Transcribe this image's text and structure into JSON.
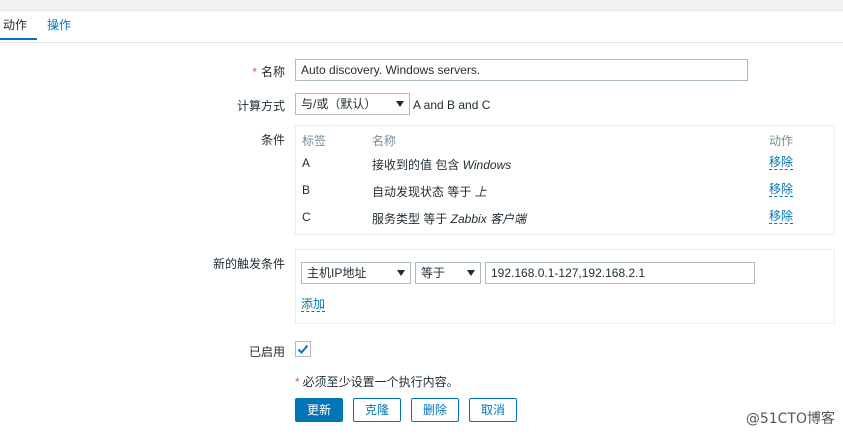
{
  "tabs": [
    {
      "label": "动作",
      "active": true
    },
    {
      "label": "操作",
      "active": false
    }
  ],
  "form": {
    "name": {
      "required_mark": "*",
      "label": "名称",
      "value": "Auto discovery. Windows servers."
    },
    "calc": {
      "label": "计算方式",
      "selected": "与/或（默认）",
      "expression": "A and B and C"
    },
    "conditions": {
      "label": "条件",
      "headers": {
        "tag": "标签",
        "name": "名称",
        "action": "动作"
      },
      "rows": [
        {
          "tag": "A",
          "prefix": "接收到的值 包含 ",
          "value": "Windows",
          "remove": "移除"
        },
        {
          "tag": "B",
          "prefix": "自动发现状态 等于 ",
          "value": "上",
          "remove": "移除"
        },
        {
          "tag": "C",
          "prefix": "服务类型 等于 ",
          "value": "Zabbix 客户端",
          "remove": "移除"
        }
      ]
    },
    "new_condition": {
      "label": "新的触发条件",
      "field_select": "主机IP地址",
      "operator_select": "等于",
      "value": "192.168.0.1-127,192.168.2.1",
      "add_label": "添加"
    },
    "enabled": {
      "label": "已启用",
      "checked": true
    },
    "note": {
      "mark": "*",
      "text": "必须至少设置一个执行内容。"
    }
  },
  "buttons": {
    "update": "更新",
    "clone": "克隆",
    "delete": "删除",
    "cancel": "取消"
  },
  "watermark": "@51CTO博客",
  "colors": {
    "accent": "#0275b8",
    "required": "#e45959",
    "text": "#1f2c33",
    "muted": "#768d99"
  }
}
